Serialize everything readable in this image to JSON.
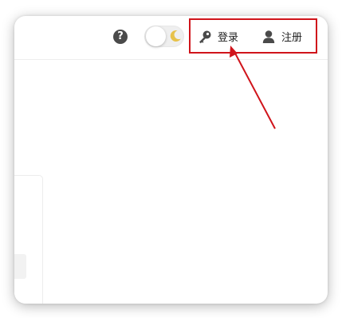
{
  "header": {
    "help_icon_glyph": "?",
    "theme_toggle": {
      "state": "light",
      "icon": "moon-icon"
    },
    "auth": {
      "login_label": "登录",
      "login_icon": "key-icon",
      "register_label": "注册",
      "register_icon": "user-icon"
    }
  },
  "annotation": {
    "highlight_color": "#d0141b"
  },
  "colors": {
    "moon": "#e7c24a",
    "icon_dark": "#4a4a4a"
  }
}
